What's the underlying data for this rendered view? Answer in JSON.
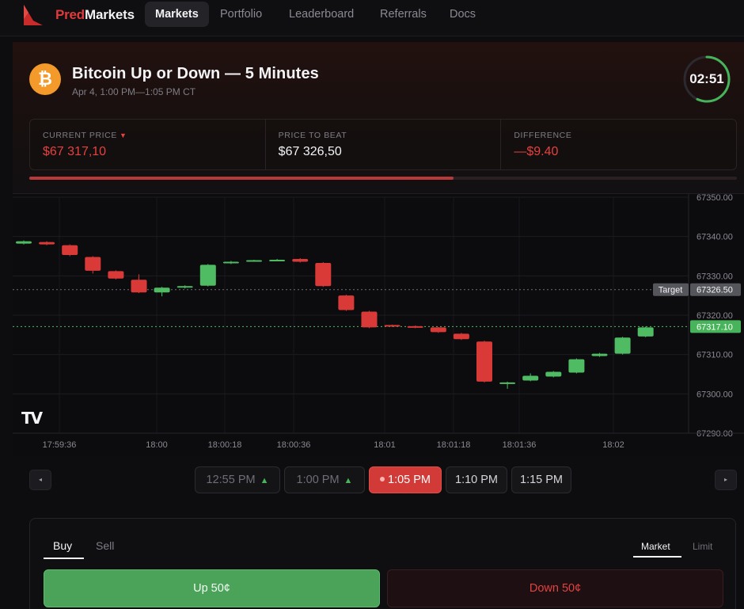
{
  "nav": {
    "brand_red": "Pred",
    "brand_white": "Markets",
    "items": [
      {
        "label": "Markets",
        "active": true
      },
      {
        "label": "Portfolio",
        "active": false
      },
      {
        "label": "Leaderboard",
        "active": false
      },
      {
        "label": "Referrals",
        "active": false
      },
      {
        "label": "Docs",
        "active": false
      }
    ]
  },
  "market": {
    "icon_glyph": "₿",
    "title": "Bitcoin Up or Down — 5 Minutes",
    "subtitle": "Apr 4, 1:00 PM—1:05 PM CT",
    "countdown": "02:51",
    "countdown_progress": 0.57,
    "progress_elapsed": 0.6,
    "stats": {
      "current_price_label": "CURRENT PRICE",
      "current_price": "$67 317,10",
      "current_direction_icon": "▼",
      "price_to_beat_label": "PRICE TO BEAT",
      "price_to_beat": "$67 326,50",
      "difference_label": "DIFFERENCE",
      "difference": "—$9.40"
    }
  },
  "chart": {
    "watermark": "TV",
    "target_label": "Target",
    "target_value": "67326.50",
    "current_value": "67317.10",
    "colors": {
      "up": "#4fbb63",
      "down": "#d93a37",
      "target_line": "#6e6e76",
      "current_line": "#4fbb63"
    }
  },
  "chart_data": {
    "type": "candlestick",
    "y_ticks": [
      "67350.00",
      "67340.00",
      "67330.00",
      "67320.00",
      "67310.00",
      "67300.00",
      "67290.00"
    ],
    "ylim": [
      67290,
      67350
    ],
    "x_ticks": [
      "17:59:36",
      "18:00",
      "18:00:18",
      "18:00:36",
      "18:01",
      "18:01:18",
      "18:01:36",
      "18:02"
    ],
    "reference_lines": [
      {
        "label": "Target",
        "value": 67326.5
      },
      {
        "label": "Current",
        "value": 67317.1
      }
    ],
    "candles": [
      {
        "o": 67338.2,
        "c": 67338.8,
        "h": 67339.0,
        "l": 67338.0
      },
      {
        "o": 67338.6,
        "c": 67338.0,
        "h": 67338.8,
        "l": 67337.8
      },
      {
        "o": 67337.8,
        "c": 67335.3,
        "h": 67338.0,
        "l": 67335.0
      },
      {
        "o": 67334.8,
        "c": 67331.3,
        "h": 67335.0,
        "l": 67330.6
      },
      {
        "o": 67331.2,
        "c": 67329.3,
        "h": 67331.4,
        "l": 67329.1
      },
      {
        "o": 67329.0,
        "c": 67325.8,
        "h": 67330.4,
        "l": 67325.6
      },
      {
        "o": 67325.8,
        "c": 67327.0,
        "h": 67327.2,
        "l": 67324.8
      },
      {
        "o": 67327.0,
        "c": 67327.4,
        "h": 67327.6,
        "l": 67326.8
      },
      {
        "o": 67327.5,
        "c": 67332.8,
        "h": 67333.0,
        "l": 67327.3
      },
      {
        "o": 67333.2,
        "c": 67333.6,
        "h": 67333.8,
        "l": 67333.0
      },
      {
        "o": 67333.7,
        "c": 67334.0,
        "h": 67334.1,
        "l": 67333.6
      },
      {
        "o": 67334.0,
        "c": 67334.1,
        "h": 67334.3,
        "l": 67333.9
      },
      {
        "o": 67334.3,
        "c": 67333.6,
        "h": 67334.5,
        "l": 67333.4
      },
      {
        "o": 67333.3,
        "c": 67327.4,
        "h": 67333.5,
        "l": 67327.2
      },
      {
        "o": 67325.0,
        "c": 67321.3,
        "h": 67325.2,
        "l": 67321.1
      },
      {
        "o": 67320.9,
        "c": 67316.9,
        "h": 67321.1,
        "l": 67316.7
      },
      {
        "o": 67317.5,
        "c": 67317.1,
        "h": 67317.6,
        "l": 67317.0
      },
      {
        "o": 67317.2,
        "c": 67316.9,
        "h": 67317.4,
        "l": 67316.7
      },
      {
        "o": 67316.9,
        "c": 67315.7,
        "h": 67317.0,
        "l": 67315.5
      },
      {
        "o": 67315.3,
        "c": 67313.9,
        "h": 67315.5,
        "l": 67313.7
      },
      {
        "o": 67313.3,
        "c": 67303.1,
        "h": 67313.5,
        "l": 67302.9
      },
      {
        "o": 67302.7,
        "c": 67302.9,
        "h": 67303.1,
        "l": 67301.3
      },
      {
        "o": 67303.4,
        "c": 67304.6,
        "h": 67305.2,
        "l": 67303.2
      },
      {
        "o": 67304.4,
        "c": 67305.6,
        "h": 67305.8,
        "l": 67304.2
      },
      {
        "o": 67305.4,
        "c": 67308.8,
        "h": 67309.0,
        "l": 67305.2
      },
      {
        "o": 67309.6,
        "c": 67310.2,
        "h": 67310.4,
        "l": 67309.4
      },
      {
        "o": 67310.2,
        "c": 67314.3,
        "h": 67314.5,
        "l": 67310.0
      },
      {
        "o": 67314.6,
        "c": 67316.9,
        "h": 67317.1,
        "l": 67314.4
      }
    ]
  },
  "time_selector": {
    "prev_icon": "◂",
    "next_icon": "▸",
    "slots": [
      {
        "label": "12:55 PM",
        "state": "past",
        "marker": "▲"
      },
      {
        "label": "1:00 PM",
        "state": "past",
        "marker": "▲"
      },
      {
        "label": "1:05 PM",
        "state": "live",
        "marker": ""
      },
      {
        "label": "1:10 PM",
        "state": "future",
        "marker": ""
      },
      {
        "label": "1:15 PM",
        "state": "future",
        "marker": ""
      }
    ]
  },
  "trade": {
    "tabs": [
      "Buy",
      "Sell"
    ],
    "active_tab": "Buy",
    "modes": [
      "Market",
      "Limit"
    ],
    "active_mode": "Market",
    "up_button": "Up 50¢",
    "down_button": "Down 50¢"
  }
}
